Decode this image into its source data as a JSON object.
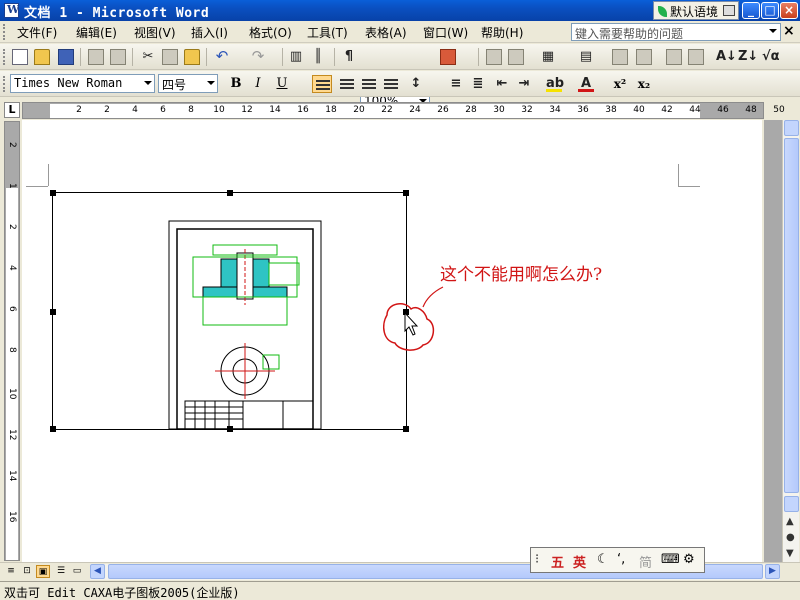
{
  "window": {
    "title": "文档 1 - Microsoft Word",
    "lang_label": "默认语境",
    "controls": [
      "_",
      "□",
      "×"
    ]
  },
  "menu": {
    "items": [
      "文件(F)",
      "编辑(E)",
      "视图(V)",
      "插入(I)",
      "格式(O)",
      "工具(T)",
      "表格(A)",
      "窗口(W)",
      "帮助(H)"
    ],
    "help_placeholder": "键入需要帮助的问题",
    "close_glyph": "×"
  },
  "toolbar": {
    "zoom": "100%"
  },
  "format": {
    "font_name": "Times New Roman",
    "font_size": "四号",
    "bold": "B",
    "italic": "I",
    "underline": "U",
    "superscript": "x²",
    "subscript": "x₂"
  },
  "ruler": {
    "corner": "L",
    "h_ticks": [
      "2",
      "2",
      "4",
      "6",
      "8",
      "10",
      "12",
      "14",
      "16",
      "18",
      "20",
      "22",
      "24",
      "26",
      "28",
      "30",
      "32",
      "34",
      "36",
      "38",
      "40",
      "42",
      "44",
      "46",
      "48",
      "50"
    ],
    "v_ticks": [
      "2",
      "1",
      "2",
      "4",
      "6",
      "8",
      "10",
      "12",
      "14",
      "16"
    ]
  },
  "document": {
    "annotation": "这个不能用啊怎么办?",
    "annotation_color": "#d11515",
    "drawing_label": "CAD drawing"
  },
  "ime": {
    "items": [
      "五",
      "英",
      "☾",
      "‘,",
      "简",
      "⌨",
      "⚙"
    ]
  },
  "status": {
    "text": "双击可 Edit CAXA电子图板2005(企业版)"
  }
}
